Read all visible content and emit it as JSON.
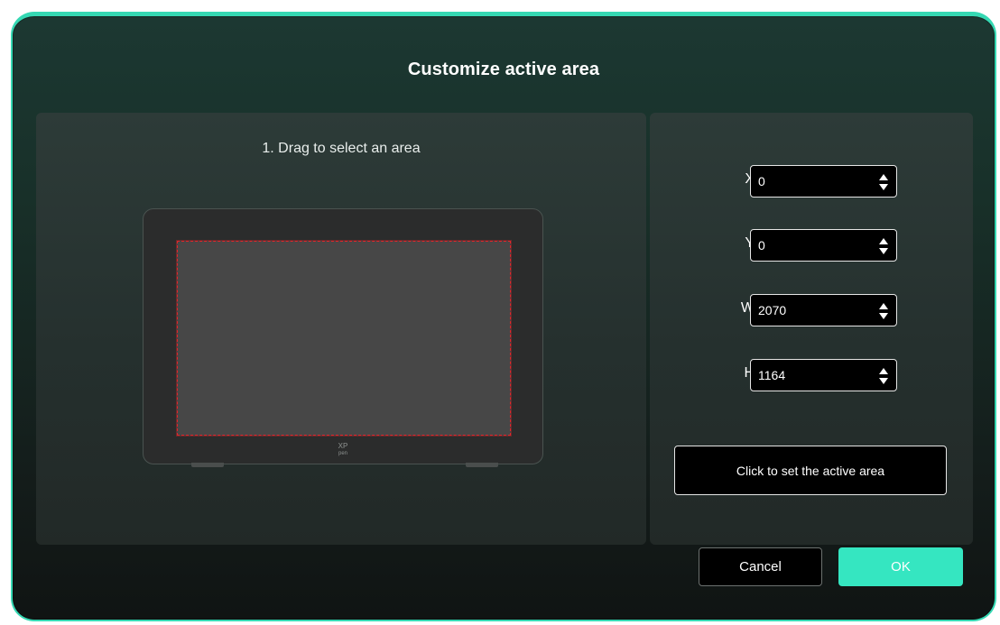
{
  "dialog": {
    "title": "Customize active area",
    "accent_color": "#35e6c1"
  },
  "left_panel": {
    "instruction": "1. Drag to select an area",
    "selection_border_color": "#e0262c",
    "brand_logo": "XP pen"
  },
  "right_panel": {
    "fields": [
      {
        "label": "X",
        "value": "0"
      },
      {
        "label": "Y",
        "value": "0"
      },
      {
        "label": "W",
        "value": "2070"
      },
      {
        "label": "H",
        "value": "1164"
      }
    ],
    "set_button_label": "Click to set the active area"
  },
  "footer": {
    "cancel_label": "Cancel",
    "ok_label": "OK"
  }
}
